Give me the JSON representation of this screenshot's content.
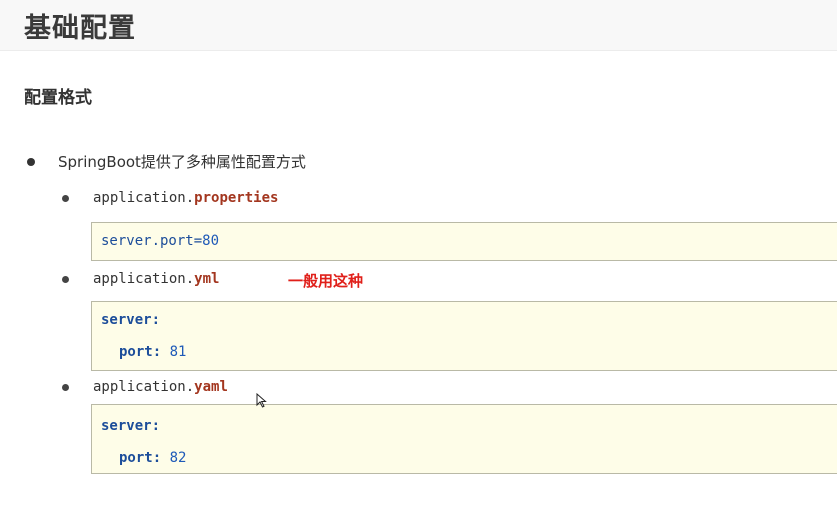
{
  "page": {
    "title": "基础配置"
  },
  "section": {
    "heading": "配置格式",
    "main_point": "SpringBoot提供了多种属性配置方式",
    "note": "一般用这种",
    "options": [
      {
        "base": "application.",
        "ext": "properties"
      },
      {
        "base": "application.",
        "ext": "yml"
      },
      {
        "base": "application.",
        "ext": "yaml"
      }
    ]
  },
  "code": {
    "properties": {
      "key": "server.port=",
      "value": "80"
    },
    "yml": {
      "key1": "server:",
      "key2": "port:",
      "value": "81"
    },
    "yaml": {
      "key1": "server:",
      "key2": "port:",
      "value": "82"
    }
  },
  "colors": {
    "extension": "#a3361f",
    "note": "#e0201a",
    "code_bg": "#fefde8",
    "code_key": "#1c4d9a"
  }
}
